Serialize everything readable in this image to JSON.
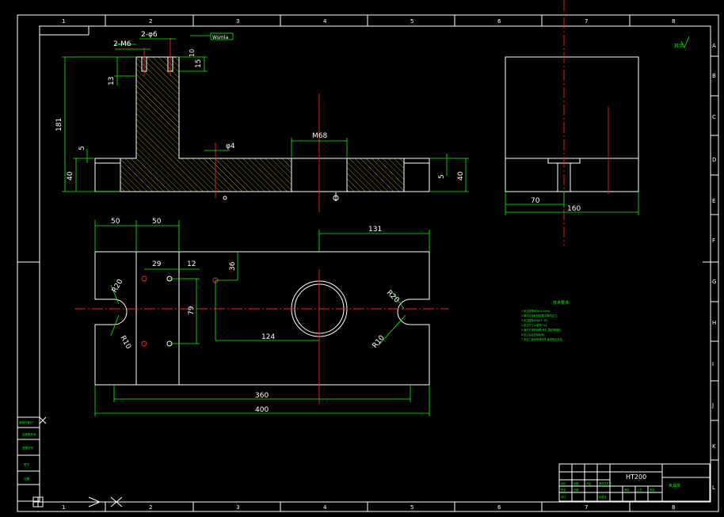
{
  "border": {
    "columns": [
      "1",
      "2",
      "3",
      "4",
      "5",
      "6",
      "7",
      "8"
    ],
    "rows": [
      "A",
      "B",
      "C",
      "D",
      "E",
      "F",
      "G",
      "H",
      "I",
      "J",
      "K",
      "L"
    ]
  },
  "front_view": {
    "dims": {
      "holes_thread": "2-M6",
      "holes_pin": "2-φ6",
      "depth_a": "15",
      "depth_b": "13",
      "height_total": "181",
      "height_base": "40",
      "step": "5",
      "hole_small": "φ4",
      "thread_big": "M68",
      "right_step": "5",
      "right_height": "40"
    },
    "flag_text": "Wsmla",
    "small_note": "10"
  },
  "side_view": {
    "dims": {
      "offset": "70",
      "width": "160"
    }
  },
  "top_view": {
    "dims": {
      "left_50a": "50",
      "left_50b": "50",
      "right_131": "131",
      "d29": "29",
      "d12": "12",
      "d36": "36",
      "d79": "79",
      "d124": "124",
      "d360": "360",
      "d400": "400",
      "r20_left": "R20",
      "r10_left": "R10",
      "r20_right": "R20",
      "r10_right": "R10"
    }
  },
  "surface_symbol": "其余",
  "tech_requirements": {
    "title": "技术要求",
    "lines": [
      "1.未注倒角均为C1,5mm。",
      "2.铸件应经时效处理,消除内应力。",
      "3.未注圆角半径R3~R5。",
      "4.未注尺寸公差按IT14。",
      "5.铸件不得有砂眼,气孔,裂纹等缺陷。",
      "6.加工后应去除毛刺。",
      "7.非加工面涂防锈底漆,面漆颜色另定。"
    ]
  },
  "title_block": {
    "material": "HT200",
    "part_name": "夹具体",
    "labels": [
      "标记",
      "处数",
      "分区",
      "更改文件号",
      "签名",
      "日期",
      "设计",
      "标准化",
      "审核",
      "工艺",
      "批准"
    ]
  },
  "left_strip": {
    "labels": [
      "借用件登记",
      "旧底图总号",
      "底图总号",
      "签字",
      "日期"
    ]
  }
}
